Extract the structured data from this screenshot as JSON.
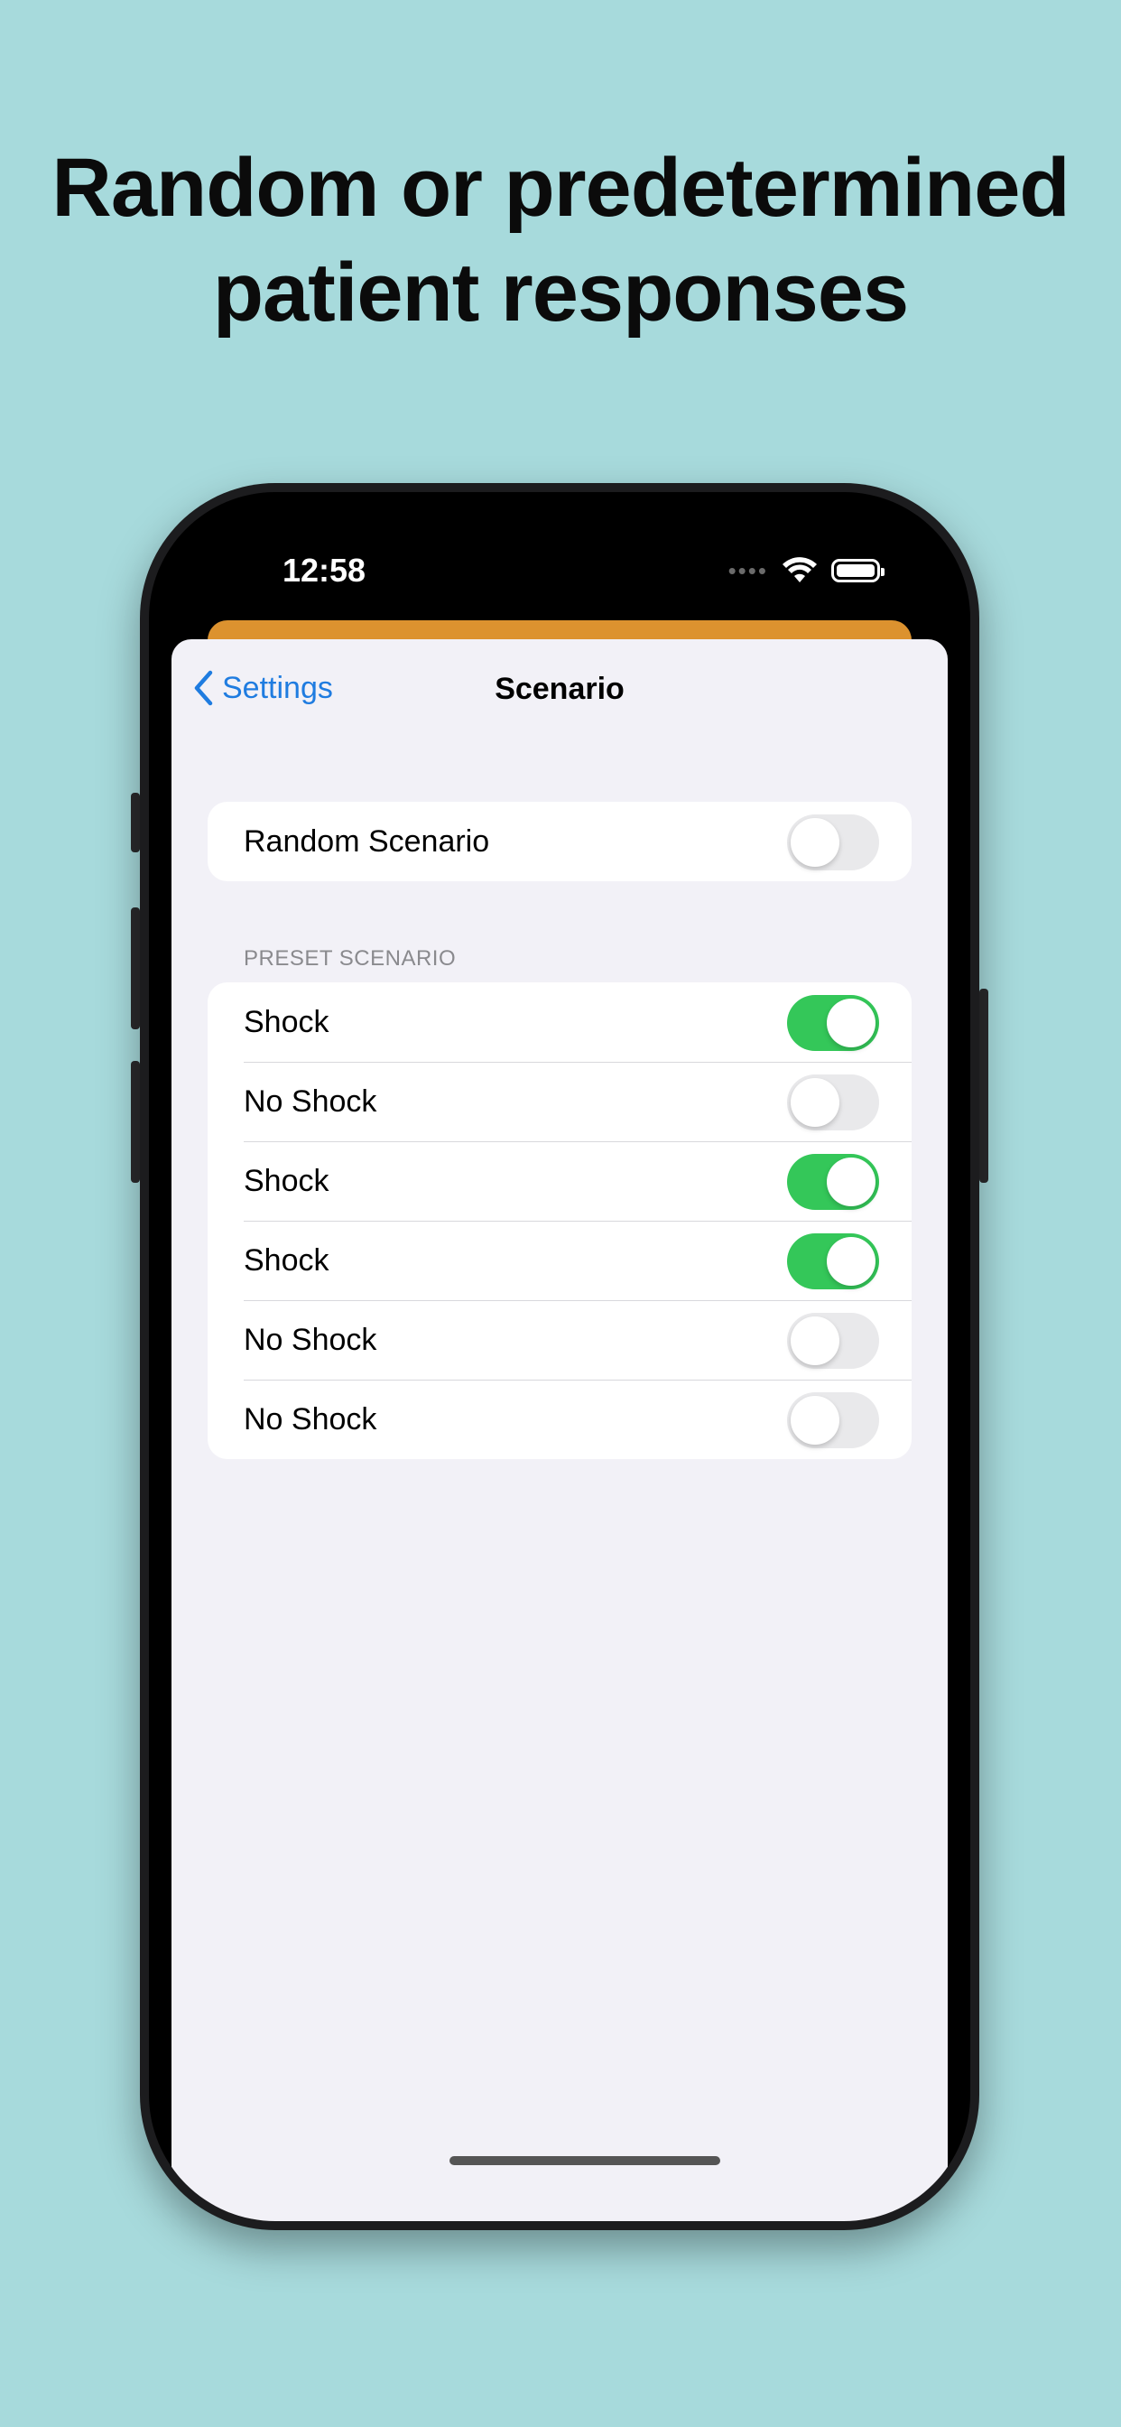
{
  "headline": {
    "line1": "Random or predetermined",
    "line2": "patient responses"
  },
  "status_bar": {
    "time": "12:58",
    "signal_icon": "signal-dots-icon",
    "wifi_icon": "wifi-icon",
    "battery_icon": "battery-icon"
  },
  "nav": {
    "back_label": "Settings",
    "back_icon": "chevron-left-icon",
    "title": "Scenario"
  },
  "random_scenario": {
    "label": "Random Scenario",
    "on": false
  },
  "preset": {
    "header": "PRESET SCENARIO",
    "items": [
      {
        "label": "Shock",
        "on": true
      },
      {
        "label": "No Shock",
        "on": false
      },
      {
        "label": "Shock",
        "on": true
      },
      {
        "label": "Shock",
        "on": true
      },
      {
        "label": "No Shock",
        "on": false
      },
      {
        "label": "No Shock",
        "on": false
      }
    ]
  },
  "colors": {
    "background": "#a7dadc",
    "accent_blue": "#1f7ce0",
    "toggle_on": "#34c759",
    "toggle_off": "#e9e9eb",
    "orange_card": "#dc922f"
  }
}
